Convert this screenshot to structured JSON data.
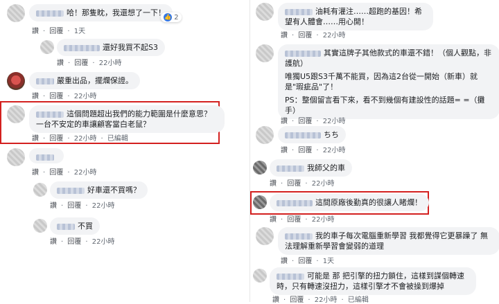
{
  "colors": {
    "highlight": "#d3201f",
    "bubble": "#f2f3f5",
    "like": "#3578e5",
    "meta": "#606770"
  },
  "actions": {
    "like": "讚",
    "reply": "回覆",
    "edited": "已編輯"
  },
  "left": [
    {
      "text": "哈！那隻眈，我還想了一下！",
      "time": "1天",
      "reaction_count": "2"
    },
    {
      "text": "還好我買不起S3",
      "time": "22小時"
    },
    {
      "text": "嚴重出品，擺爛保證。",
      "time": "22小時"
    },
    {
      "text": "這個問題超出我們的能力範圍是什麼意思？一台不安定的車讓顧客當白老鼠？",
      "time": "22小時"
    },
    {
      "text": "",
      "time": "22小時"
    },
    {
      "text": "好車還不買嗎？",
      "time": "22小時"
    },
    {
      "text": "不買",
      "time": "22小時"
    }
  ],
  "right": [
    {
      "text": "油耗有灌注……超跑的基因！希望有人體會……用心開！",
      "time": "22小時"
    },
    {
      "text": "其實這牌子其他款式的車還不錯！（個人觀點，非護航）",
      "text2": "唯獨U5跟S3千萬不能買，因為這2台從一開始（新車）就是\"瑕疵品\"了！",
      "text3": "PS：整個留言看下來，看不到幾個有建設性的話題= =（攤手）",
      "time": "22小時"
    },
    {
      "text": "ちち",
      "time": "22小時"
    },
    {
      "text": "我師父的車",
      "time": "22小時"
    },
    {
      "text": "這間原廠後勤真的很讓人睹爛！",
      "time": "22小時"
    },
    {
      "text": "我的車子每次電腦重新學習 我都覺得它更暴躁了 無法理解重新學習會變弱的道理",
      "time": "1天"
    },
    {
      "text": "可能是 那 把引擎的扭力鎖住，這樣到謀個轉速時，只有轉速沒扭力，這樣引擎才不會被操到爆掉",
      "time": "22小時"
    }
  ]
}
